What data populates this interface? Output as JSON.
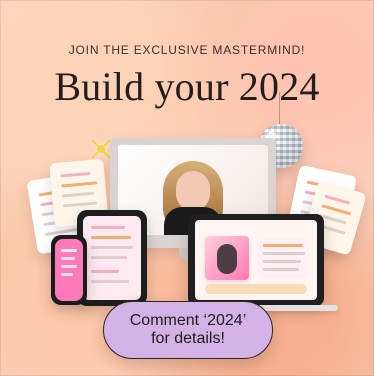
{
  "header": {
    "eyebrow": "JOIN THE EXCLUSIVE MASTERMIND!",
    "headline": "Build your 2024"
  },
  "cta": {
    "line1": "Comment ‘2024’",
    "line2": "for details!"
  },
  "colors": {
    "headline": "#241d1d",
    "cta_fill": "#d4b2e6",
    "cta_border": "#2b2525",
    "sparkle": "#f2d54a"
  },
  "icons": {
    "sparkle": "sparkle-icon",
    "disco_ball": "disco-ball-icon"
  }
}
